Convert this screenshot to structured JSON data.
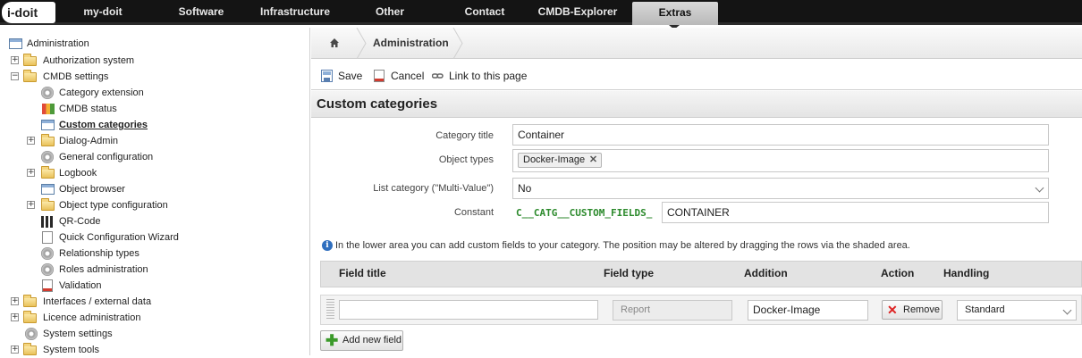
{
  "topnav": {
    "logo": "i-doit",
    "items": [
      "my-doit",
      "Software",
      "Infrastructure",
      "Other",
      "Contact",
      "CMDB-Explorer",
      "Extras"
    ],
    "active": "Extras"
  },
  "sidebar": {
    "root": "Administration",
    "items": [
      {
        "label": "Authorization system"
      },
      {
        "label": "CMDB settings"
      },
      {
        "label": "Category extension"
      },
      {
        "label": "CMDB status"
      },
      {
        "label": "Custom categories"
      },
      {
        "label": "Dialog-Admin"
      },
      {
        "label": "General configuration"
      },
      {
        "label": "Logbook"
      },
      {
        "label": "Object browser"
      },
      {
        "label": "Object type configuration"
      },
      {
        "label": "QR-Code"
      },
      {
        "label": "Quick Configuration Wizard"
      },
      {
        "label": "Relationship types"
      },
      {
        "label": "Roles administration"
      },
      {
        "label": "Validation"
      },
      {
        "label": "Interfaces / external data"
      },
      {
        "label": "Licence administration"
      },
      {
        "label": "System settings"
      },
      {
        "label": "System tools"
      }
    ]
  },
  "breadcrumb": {
    "current": "Administration"
  },
  "toolbar": {
    "save": "Save",
    "cancel": "Cancel",
    "link": "Link to this page"
  },
  "section": {
    "title": "Custom categories"
  },
  "form": {
    "category_title_label": "Category title",
    "category_title_value": "Container",
    "object_types_label": "Object types",
    "object_types_tag": "Docker-Image",
    "list_category_label": "List category (\"Multi-Value\")",
    "list_category_value": "No",
    "constant_label": "Constant",
    "constant_prefix": "C__CATG__CUSTOM_FIELDS_",
    "constant_value": "CONTAINER"
  },
  "info": "In the lower area you can add custom fields to your category. The position may be altered by dragging the rows via the shaded area.",
  "table": {
    "headers": [
      "Field title",
      "Field type",
      "Addition",
      "Action",
      "Handling"
    ],
    "row": {
      "field_title": "",
      "field_type": "Report",
      "addition": "Docker-Image",
      "action": "Remove",
      "handling": "Standard"
    }
  },
  "add_field_label": "Add new field"
}
